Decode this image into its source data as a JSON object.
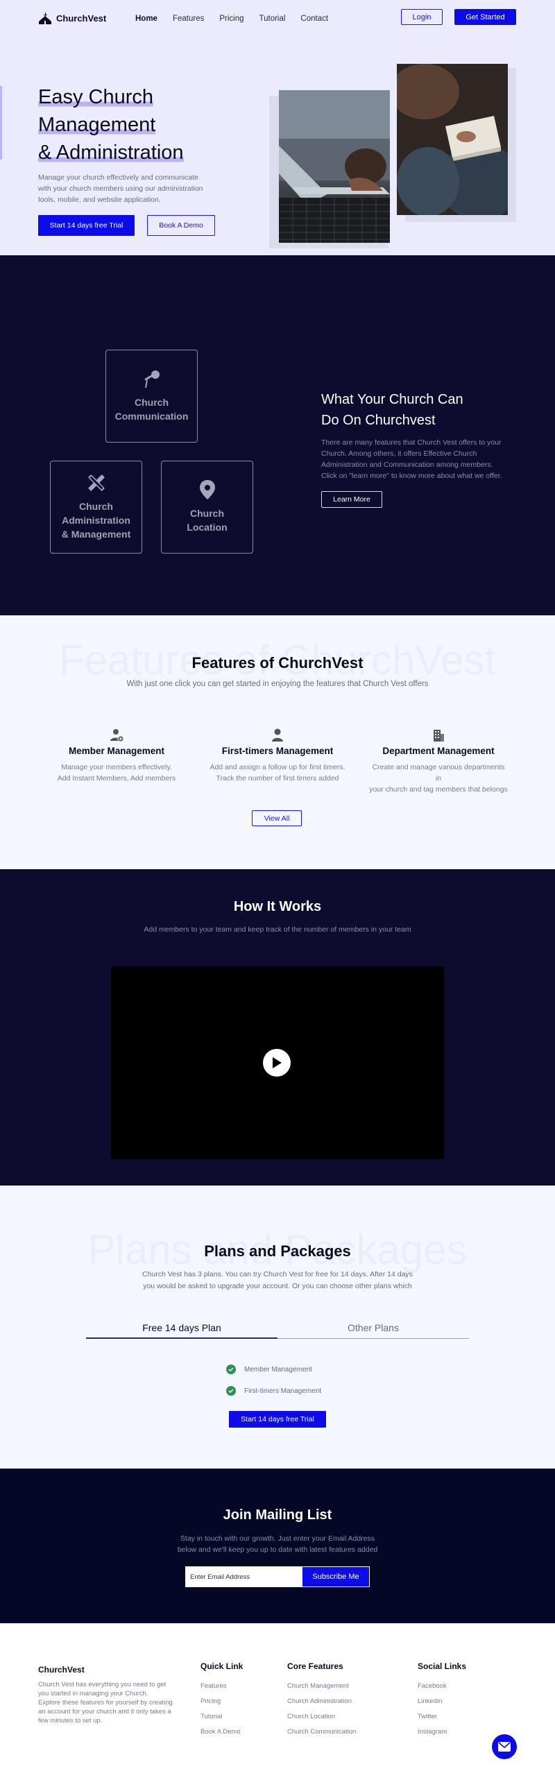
{
  "brand": {
    "name": "ChurchVest"
  },
  "nav": {
    "items": [
      {
        "label": "Home"
      },
      {
        "label": "Features"
      },
      {
        "label": "Pricing"
      },
      {
        "label": "Tutorial"
      },
      {
        "label": "Contact"
      }
    ],
    "login": "Login",
    "get_started": "Get Started"
  },
  "hero": {
    "title_lines": [
      "Easy Church",
      "Management",
      "& Administration"
    ],
    "description": "Manage your church effectively and communicate with your church members using our administration tools, mobile, and website application.",
    "cta_primary": "Start 14 days free Trial",
    "cta_secondary": "Book A Demo"
  },
  "capabilities": {
    "boxes": [
      {
        "title_lines": [
          "Church",
          "Communication"
        ],
        "icon": "microphone-icon"
      },
      {
        "title_lines": [
          "Church",
          "Administration",
          "& Management"
        ],
        "icon": "pencil-ruler-icon"
      },
      {
        "title_lines": [
          "Church",
          "Location"
        ],
        "icon": "location-pin-icon"
      }
    ],
    "title_lines": [
      "What Your Church Can",
      "Do On Churchvest"
    ],
    "description": "There are many features that Church Vest offers to your Church. Among others, it offers Effective Church Administration and Communication among members. Click on \"learn more\" to know more about what we offer.",
    "learn_more": "Learn More"
  },
  "features": {
    "ghost": "Features of ChurchVest",
    "title": "Features of ChurchVest",
    "subtitle": "With just one click you can get started in enjoying the features that Church Vest offers",
    "items": [
      {
        "title": "Member Management",
        "icon": "user-add-icon",
        "desc_lines": [
          "Manage your members effectively.",
          "Add Instant Members, Add members"
        ]
      },
      {
        "title": "First-timers Management",
        "icon": "user-icon",
        "desc_lines": [
          "Add and assign a follow up for first timers.",
          "Track the number of first timers added"
        ]
      },
      {
        "title": "Department Management",
        "icon": "building-icon",
        "desc_lines": [
          "Create and manage various departments in",
          "your church and tag members that belongs"
        ]
      }
    ],
    "view_all": "View All"
  },
  "how": {
    "title": "How It Works",
    "subtitle": "Add members to your team and keep track of the number of members in your team"
  },
  "plans": {
    "ghost": "Plans and Packages",
    "title": "Plans and Packages",
    "desc_lines": [
      "Church Vest has 3 plans. You can try Church Vest for free for 14 days. After 14 days",
      "you would be asked to upgrade your account. Or you can choose other plans which"
    ],
    "tabs": [
      {
        "label": "Free 14 days Plan"
      },
      {
        "label": "Other Plans"
      }
    ],
    "features": [
      "Member Management",
      "First-timers Management"
    ],
    "cta": "Start 14 days free Trial"
  },
  "mailing": {
    "title": "Join Mailing List",
    "desc_lines": [
      "Stay in touch with our growth. Just enter your Email Address",
      "below and we'll keep you up to date with latest features added"
    ],
    "placeholder": "Enter Email Address",
    "subscribe": "Subscribe Me"
  },
  "footer": {
    "brand": "ChurchVest",
    "desc_lines": [
      "Church Vest has everything you need to get",
      "you started in managing your Church.",
      "Explore these features for yourself by creating",
      "an account for your church and it only takes a",
      "few minutes to set up."
    ],
    "quick_links": {
      "title": "Quick Link",
      "links": [
        "Features",
        "Pricing",
        "Tutorial",
        "Book A Demo"
      ]
    },
    "core_features": {
      "title": "Core Features",
      "links": [
        "Church Management",
        "Church Administration",
        "Church Location",
        "Church Communication"
      ]
    },
    "social": {
      "title": "Social Links",
      "links": [
        "Facebook",
        "Linkedin",
        "Twitter",
        "Instagram"
      ]
    }
  },
  "colors": {
    "accent": "#0e0bea",
    "dark": "#0e0c2e",
    "hero_bg": "#ebebfd",
    "check": "#2f8f54"
  }
}
